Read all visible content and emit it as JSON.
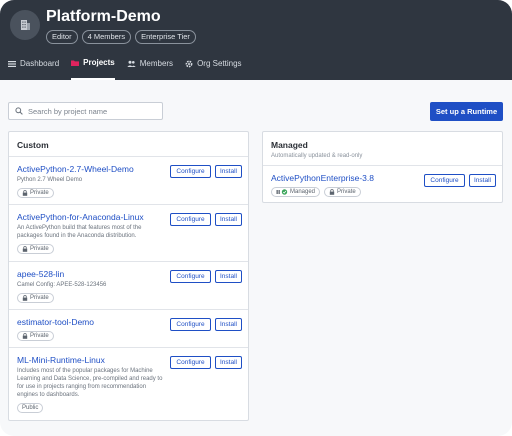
{
  "org": {
    "title": "Platform-Demo",
    "badges": [
      "Editor",
      "4 Members",
      "Enterprise Tier"
    ]
  },
  "tabs": [
    {
      "label": "Dashboard",
      "icon": "list-icon",
      "active": false
    },
    {
      "label": "Projects",
      "icon": "folder-icon",
      "active": true
    },
    {
      "label": "Members",
      "icon": "members-icon",
      "active": false
    },
    {
      "label": "Org Settings",
      "icon": "gear-icon",
      "active": false
    }
  ],
  "search": {
    "placeholder": "Search by project name"
  },
  "actions": {
    "setup_runtime": "Set up a Runtime"
  },
  "custom": {
    "title": "Custom",
    "projects": [
      {
        "name": "ActivePython-2.7-Wheel-Demo",
        "desc": "Python 2.7 Wheel Demo",
        "tags": [
          {
            "label": "Private",
            "icon": "lock-icon"
          }
        ]
      },
      {
        "name": "ActivePython-for-Anaconda-Linux",
        "desc": "An ActivePython build that features most of the packages found in the Anaconda distribution.",
        "tags": [
          {
            "label": "Private",
            "icon": "lock-icon"
          }
        ]
      },
      {
        "name": "apee-528-lin",
        "desc": "Camel Config: APEE-528-123456",
        "tags": [
          {
            "label": "Private",
            "icon": "lock-icon"
          }
        ]
      },
      {
        "name": "estimator-tool-Demo",
        "desc": "",
        "tags": [
          {
            "label": "Private",
            "icon": "lock-icon"
          }
        ]
      },
      {
        "name": "ML-Mini-Runtime-Linux",
        "desc": "Includes most of the popular packages for Machine Learning and Data Science, pre-compiled and ready to for use in projects ranging from recommendation engines to dashboards.",
        "tags": [
          {
            "label": "Public",
            "icon": ""
          }
        ]
      }
    ]
  },
  "managed": {
    "title": "Managed",
    "subtitle": "Automatically updated & read-only",
    "projects": [
      {
        "name": "ActivePythonEnterprise-3.8",
        "tags": [
          {
            "label": "Managed",
            "icon": "managed-icon"
          },
          {
            "label": "Private",
            "icon": "lock-icon"
          }
        ]
      }
    ]
  },
  "buttons": {
    "configure": "Configure",
    "install": "Install"
  },
  "colors": {
    "header_bg": "#2f3640",
    "accent": "#1f4fc5",
    "managed_check": "#3aa55a"
  }
}
